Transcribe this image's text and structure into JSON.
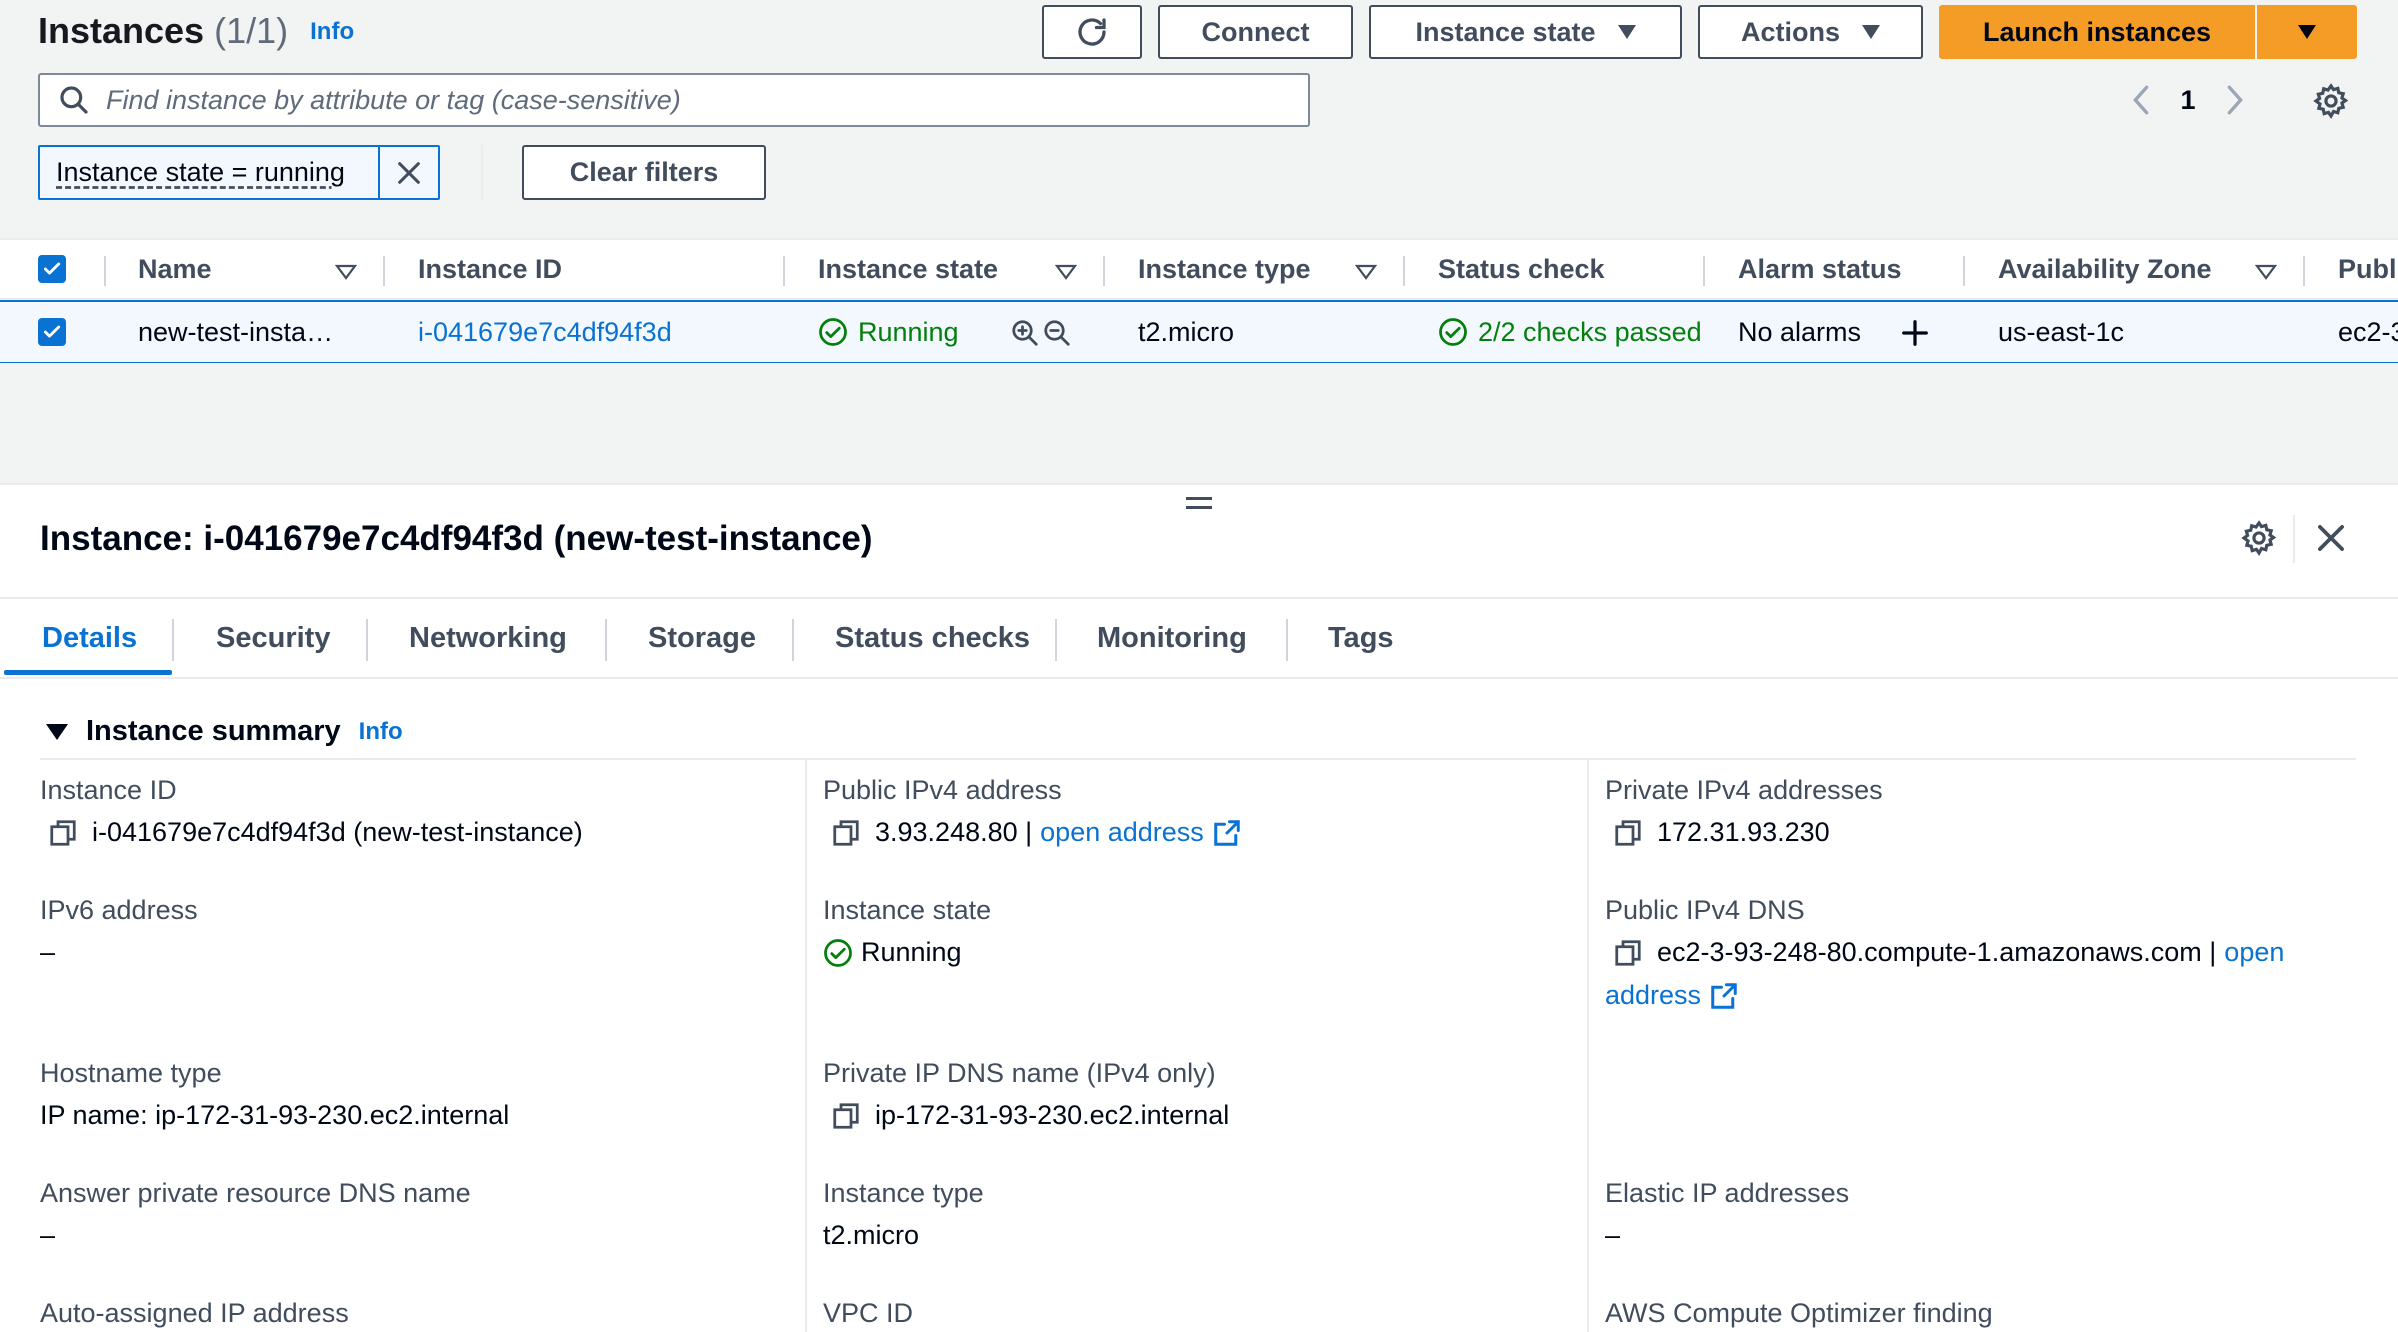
{
  "header": {
    "title": "Instances",
    "count": "(1/1)",
    "info": "Info",
    "connect_label": "Connect",
    "instance_state_label": "Instance state",
    "actions_label": "Actions",
    "launch_label": "Launch instances"
  },
  "search": {
    "placeholder": "Find instance by attribute or tag (case-sensitive)"
  },
  "pagination": {
    "page": "1"
  },
  "filter": {
    "token": "Instance state = running",
    "clear_label": "Clear filters"
  },
  "table": {
    "columns": [
      "Name",
      "Instance ID",
      "Instance state",
      "Instance type",
      "Status check",
      "Alarm status",
      "Availability Zone",
      "Publ"
    ],
    "row": {
      "name": "new-test-insta…",
      "instance_id": "i-041679e7c4df94f3d",
      "state": "Running",
      "type": "t2.micro",
      "status_check": "2/2 checks passed",
      "alarm": "No alarms",
      "az": "us-east-1c",
      "public_dns": "ec2-3"
    }
  },
  "panel": {
    "title": "Instance: i-041679e7c4df94f3d (new-test-instance)",
    "tabs": [
      "Details",
      "Security",
      "Networking",
      "Storage",
      "Status checks",
      "Monitoring",
      "Tags"
    ],
    "section_title": "Instance summary",
    "section_info": "Info",
    "fields": {
      "instance_id_label": "Instance ID",
      "instance_id_value": "i-041679e7c4df94f3d (new-test-instance)",
      "public_ipv4_label": "Public IPv4 address",
      "public_ipv4_value": "3.93.248.80 |",
      "open_address": "open address",
      "private_ipv4_label": "Private IPv4 addresses",
      "private_ipv4_value": "172.31.93.230",
      "ipv6_label": "IPv6 address",
      "ipv6_value": "–",
      "instance_state_label": "Instance state",
      "instance_state_value": "Running",
      "public_dns_label": "Public IPv4 DNS",
      "public_dns_value": "ec2-3-93-248-80.compute-1.amazonaws.com |",
      "open_part1": "open",
      "open_part2": "address",
      "hostname_type_label": "Hostname type",
      "hostname_type_value": "IP name: ip-172-31-93-230.ec2.internal",
      "private_dns_label": "Private IP DNS name (IPv4 only)",
      "private_dns_value": "ip-172-31-93-230.ec2.internal",
      "answer_dns_label": "Answer private resource DNS name",
      "answer_dns_value": "–",
      "instance_type_label": "Instance type",
      "instance_type_value": "t2.micro",
      "elastic_ip_label": "Elastic IP addresses",
      "elastic_ip_value": "–",
      "auto_ip_label": "Auto-assigned IP address",
      "vpc_id_label": "VPC ID",
      "optimizer_label": "AWS Compute Optimizer finding"
    }
  },
  "colors": {
    "accent": "#0972d3",
    "primary_button": "#f59c27",
    "success": "#037f0c"
  }
}
